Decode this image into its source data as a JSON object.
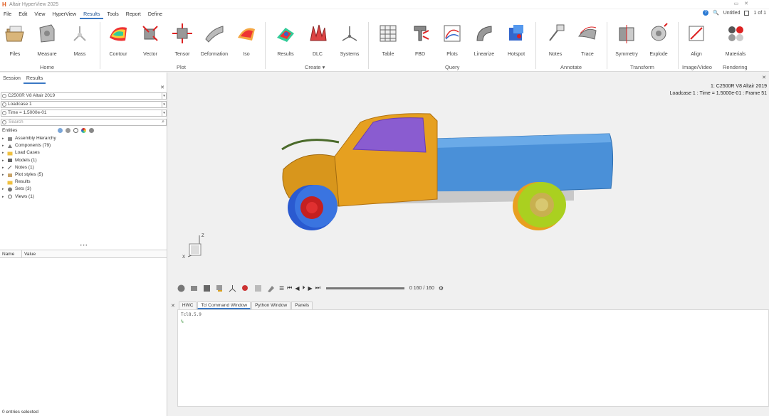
{
  "titlebar": {
    "app_title": "Altair HyperView 2025",
    "logo": "H",
    "controls": "▭ ✕"
  },
  "menu": {
    "items": [
      "File",
      "Edit",
      "View",
      "HyperView",
      "Results",
      "Tools",
      "Report",
      "Define"
    ],
    "active": "Results",
    "right": {
      "untitled": "Untitled",
      "page_info": "1 of 1"
    }
  },
  "ribbon": {
    "tools": [
      {
        "label": "Files",
        "icon": "files-icon"
      },
      {
        "label": "Measure",
        "icon": "measure-icon"
      },
      {
        "label": "Mass",
        "icon": "mass-icon"
      },
      {
        "label": "Contour",
        "icon": "contour-icon"
      },
      {
        "label": "Vector",
        "icon": "vector-icon"
      },
      {
        "label": "Tensor",
        "icon": "tensor-icon"
      },
      {
        "label": "Deformation",
        "icon": "deformation-icon"
      },
      {
        "label": "Iso",
        "icon": "iso-icon"
      },
      {
        "label": "Results",
        "icon": "results-icon"
      },
      {
        "label": "DLC",
        "icon": "dlc-icon"
      },
      {
        "label": "Systems",
        "icon": "systems-icon"
      },
      {
        "label": "Table",
        "icon": "table-icon"
      },
      {
        "label": "FBD",
        "icon": "fbd-icon"
      },
      {
        "label": "Plots",
        "icon": "plots-icon"
      },
      {
        "label": "Linearize",
        "icon": "linearize-icon"
      },
      {
        "label": "Hotspot",
        "icon": "hotspot-icon"
      },
      {
        "label": "Notes",
        "icon": "notes-icon"
      },
      {
        "label": "Trace",
        "icon": "trace-icon"
      },
      {
        "label": "Symmetry",
        "icon": "symmetry-icon"
      },
      {
        "label": "Explode",
        "icon": "explode-icon"
      },
      {
        "label": "Align",
        "icon": "align-icon"
      },
      {
        "label": "Materials",
        "icon": "materials-icon"
      }
    ],
    "groups": [
      "Home",
      "Plot",
      "Create ▾",
      "Query",
      "Annotate",
      "Transform",
      "Image/Video",
      "Rendering"
    ]
  },
  "left_panel": {
    "tabs": [
      "Session",
      "Results"
    ],
    "model_select": "C2500R V8 Altair 2019",
    "loadcase_select": "Loadcase 1",
    "time_select": "Time = 1.5000e-01",
    "search_placeholder": "Search",
    "entities_label": "Entities",
    "tree": [
      {
        "label": "Assembly Hierarchy",
        "icon": "assembly-icon"
      },
      {
        "label": "Components (79)",
        "icon": "components-icon"
      },
      {
        "label": "Load Cases",
        "icon": "folder-icon"
      },
      {
        "label": "Models (1)",
        "icon": "models-icon"
      },
      {
        "label": "Notes (1)",
        "icon": "notes-icon"
      },
      {
        "label": "Plot styles (5)",
        "icon": "plotstyles-icon"
      },
      {
        "label": "Results",
        "icon": "folder-icon"
      },
      {
        "label": "Sets (3)",
        "icon": "sets-icon"
      },
      {
        "label": "Views (1)",
        "icon": "views-icon"
      }
    ],
    "props_columns": [
      "Name",
      "Value"
    ],
    "status": "0 entries selected"
  },
  "viewport": {
    "info_line1": "1: C2500R V8 Altair 2019",
    "info_line2": "Loadcase 1 : Time = 1.5000e-01 : Frame 51",
    "triad_z": "Z",
    "triad_x": "X"
  },
  "playback": {
    "frames": "0 160 / 160"
  },
  "console": {
    "tabs": [
      "HWC",
      "Tcl Command Window",
      "Python Window",
      "Panels"
    ],
    "active_tab": "Tcl Command Window",
    "version_line": "Tcl8.5.9",
    "prompt": "%"
  },
  "colors": {
    "accent": "#3a78c4",
    "cab": "#e6a020",
    "bed": "#4a90d8",
    "window": "#8a5cd0",
    "tire_blue": "#2a5ad0",
    "tire_green": "#aad020"
  }
}
